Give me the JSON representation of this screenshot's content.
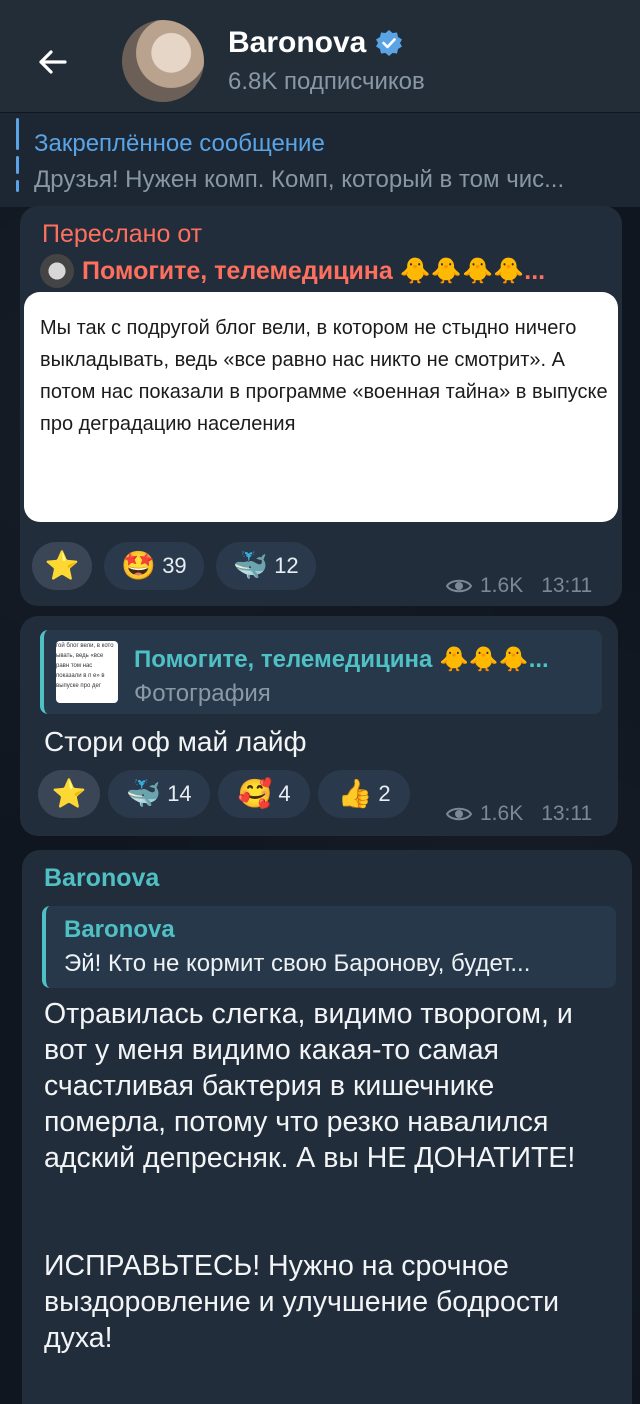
{
  "header": {
    "channel_name": "Baronova",
    "subscribers": "6.8K подписчиков"
  },
  "pinned": {
    "title": "Закреплённое сообщение",
    "text": "Друзья! Нужен комп. Комп, который в том чис..."
  },
  "messages": [
    {
      "forwarded_label": "Переслано от",
      "forwarded_source": "Помогите, телемедицина 🐥🐥🐥🐥...",
      "image_text": "Мы так с подругой блог вели, в котором не стыдно ничего выкладывать, ведь «все равно нас никто не смотрит». А потом нас показали в программе «военная тайна» в выпуске про деградацию населения",
      "reactions": [
        {
          "emoji": "⭐",
          "count": ""
        },
        {
          "emoji": "🤩",
          "count": "39"
        },
        {
          "emoji": "🐳",
          "count": "12"
        }
      ],
      "views": "1.6K",
      "time": "13:11"
    },
    {
      "reply_name": "Помогите, телемедицина 🐥🐥🐥...",
      "reply_sub": "Фотография",
      "reply_thumb_text": "гой блог вели, в кото ывать, ведь «все равн том нас показали в п е» в выпуске про дег",
      "text": "Стори оф май лайф",
      "reactions": [
        {
          "emoji": "⭐",
          "count": ""
        },
        {
          "emoji": "🐳",
          "count": "14"
        },
        {
          "emoji": "🥰",
          "count": "4"
        },
        {
          "emoji": "👍",
          "count": "2"
        }
      ],
      "views": "1.6K",
      "time": "13:11"
    },
    {
      "author": "Baronova",
      "reply_name": "Baronova",
      "reply_sub": "Эй! Кто не кормит свою Баронову, будет...",
      "paragraph1": "Отравилась слегка, видимо творогом, и вот у меня видимо какая-то самая счастливая бактерия в кишечнике померла, потому что резко навалился адский депресняк. А вы НЕ ДОНАТИТЕ!",
      "paragraph2": "ИСПРАВЬТЕСЬ! Нужно на срочное выздоровление и улучшение бодрости духа!"
    }
  ],
  "colors": {
    "accent": "#5aa4e6",
    "forward": "#ff6f5e",
    "reply": "#4fc1c5",
    "bubble": "#212d3b"
  },
  "icons": [
    "back-arrow-icon",
    "verified-icon",
    "eye-icon"
  ]
}
